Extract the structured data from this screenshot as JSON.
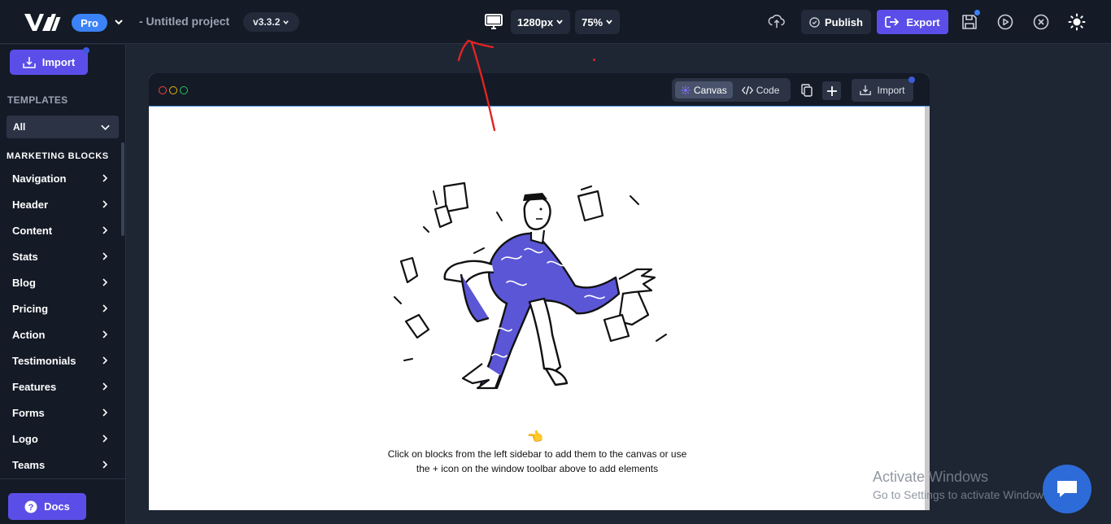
{
  "topbar": {
    "plan_badge": "Pro",
    "project_title": "- Untitled project",
    "version": "v3.3.2",
    "width_option": "1280px",
    "zoom": "75%",
    "publish_label": "Publish",
    "export_label": "Export",
    "brand_color": "#5b4ee8",
    "badge_color": "#3b82f6"
  },
  "sidebar": {
    "import_label": "Import",
    "templates_title": "TEMPLATES",
    "templates_filter": "All",
    "blocks_title": "MARKETING BLOCKS",
    "items": [
      {
        "label": "Navigation"
      },
      {
        "label": "Header"
      },
      {
        "label": "Content"
      },
      {
        "label": "Stats"
      },
      {
        "label": "Blog"
      },
      {
        "label": "Pricing"
      },
      {
        "label": "Action"
      },
      {
        "label": "Testimonials"
      },
      {
        "label": "Features"
      },
      {
        "label": "Forms"
      },
      {
        "label": "Logo"
      },
      {
        "label": "Teams"
      }
    ],
    "docs_label": "Docs"
  },
  "window": {
    "canvas_tab": "Canvas",
    "code_tab": "Code",
    "import_label": "Import",
    "hint_line1": "Click on blocks from the left sidebar to add them to the canvas or use",
    "hint_line2": "the + icon on the window toolbar above to add elements",
    "pointer_emoji": "👈"
  },
  "watermark": {
    "line1": "Activate Windows",
    "line2": "Go to Settings to activate Windows."
  }
}
